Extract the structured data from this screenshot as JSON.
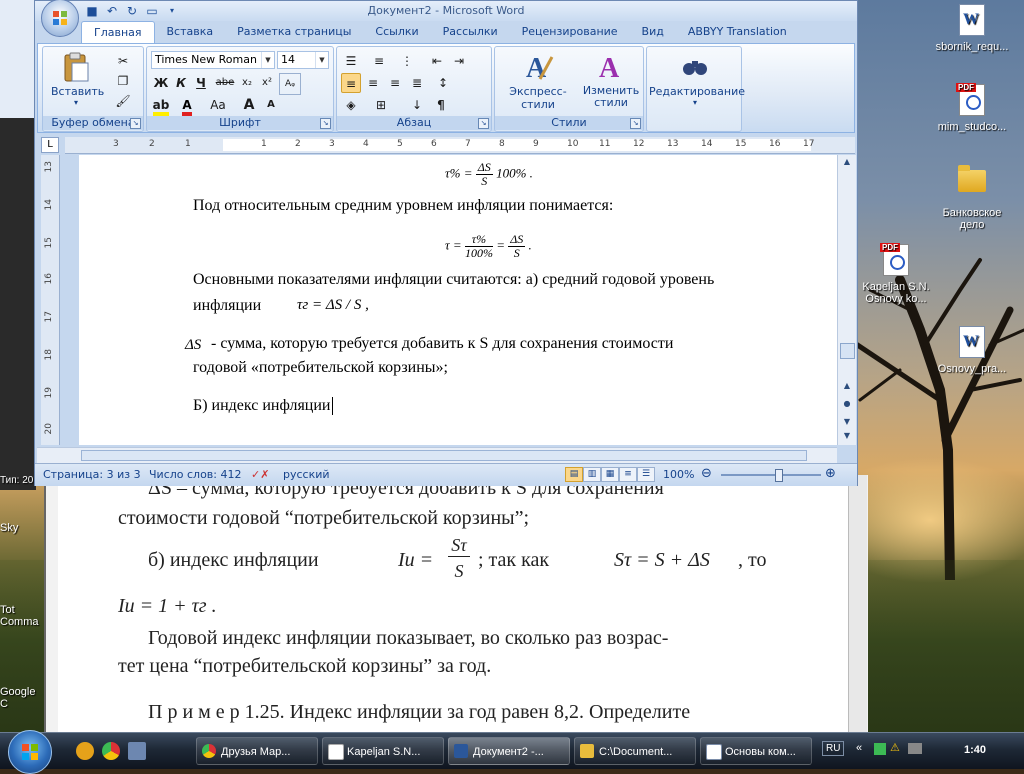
{
  "window": {
    "title": "Документ2 - Microsoft Word"
  },
  "ribbon": {
    "tabs": [
      "Главная",
      "Вставка",
      "Разметка страницы",
      "Ссылки",
      "Рассылки",
      "Рецензирование",
      "Вид",
      "ABBYY Translation"
    ],
    "active_tab": "Главная",
    "clipboard": {
      "group": "Буфер обмена",
      "paste": "Вставить"
    },
    "font": {
      "group": "Шрифт",
      "font_name": "Times New Roman",
      "font_size": "14",
      "bold": "Ж",
      "italic": "К",
      "underline": "Ч",
      "strike": "abe",
      "sub": "x₂",
      "sup": "x²",
      "grow": "A",
      "shrink": "A",
      "case": "Аа",
      "color_letter": "А"
    },
    "paragraph": {
      "group": "Абзац"
    },
    "styles": {
      "group": "Стили",
      "express": "Экспресс-стили",
      "change": "Изменить стили"
    },
    "editing": {
      "group": "Редактирование",
      "label": "Редактирование"
    }
  },
  "ruler": {
    "h_numbers": [
      "3",
      "2",
      "1",
      "1",
      "2",
      "3",
      "4",
      "5",
      "6",
      "7",
      "8",
      "9",
      "10",
      "11",
      "12",
      "13",
      "14",
      "15",
      "16",
      "17"
    ],
    "v_numbers": [
      "13",
      "14",
      "15",
      "16",
      "17",
      "18",
      "19",
      "20"
    ]
  },
  "document": {
    "formula1": {
      "lhs": "τ% =",
      "num": "ΔS",
      "den": "S",
      "rhs": "100% ."
    },
    "line1": "Под относительным средним уровнем инфляции понимается:",
    "formula2": {
      "lhs": "τ =",
      "num1": "τ%",
      "den1": "100%",
      "eq": "=",
      "num2": "ΔS",
      "den2": "S",
      "end": "."
    },
    "line2": "Основными показателями инфляции считаются: а) средний годовой уровень",
    "line3a": "инфляции",
    "line3b": "τг = ΔS / S ,",
    "line4a": "ΔS",
    "line4b": "- сумма, которую требуется добавить к S для сохранения стоимости",
    "line5": "годовой «потребительской корзины»;",
    "line6": "Б) индекс инфляции"
  },
  "statusbar": {
    "page": "Страница: 3 из 3",
    "words": "Число слов: 412",
    "lang": "русский",
    "zoom": "100%"
  },
  "reader": {
    "l1": "ΔS  – сумма, которую требуется добавить к S для сохранения",
    "l2": "стоимости годовой “потребительской корзины”;",
    "l3a": "б)   индекс   инфляции",
    "l3b": "Iи =",
    "l3c": "Sτ",
    "l3d": "S",
    "l3e": ";    так    как",
    "l3f": "Sτ = S + ΔS",
    "l3g": ",   то",
    "l4": "Iи = 1 + τг .",
    "l5": "Годовой индекс инфляции показывает, во сколько раз возрас-",
    "l6": "тет цена “потребительской корзины” за год.",
    "l7": "П р и м е р  1.25. Индекс инфляции за год равен 8,2. Определите"
  },
  "desktop": {
    "icons": [
      {
        "label": "sbornik_requ...",
        "type": "word"
      },
      {
        "label": "mim_studco...",
        "type": "pdf"
      },
      {
        "label": "Банковское дело",
        "type": "folder"
      },
      {
        "label": "Kapeljan S.N. Osnovy ko...",
        "type": "pdf"
      },
      {
        "label": "Osnovy_pra...",
        "type": "word"
      }
    ],
    "left_labels": [
      "Тип: 20",
      "Sky",
      "Tot Comma",
      "Google C"
    ]
  },
  "taskbar": {
    "buttons": [
      {
        "label": "Друзья Мар...",
        "active": false
      },
      {
        "label": "Kapeljan S.N...",
        "active": false
      },
      {
        "label": "Документ2 -...",
        "active": true
      },
      {
        "label": "C:\\Document...",
        "active": false
      },
      {
        "label": "Основы ком...",
        "active": false
      }
    ],
    "lang": "RU",
    "clock": "1:40"
  },
  "colors": {
    "ribbon_text": "#15428b",
    "highlight": "#fbd78a",
    "accent": "#2b579a"
  }
}
